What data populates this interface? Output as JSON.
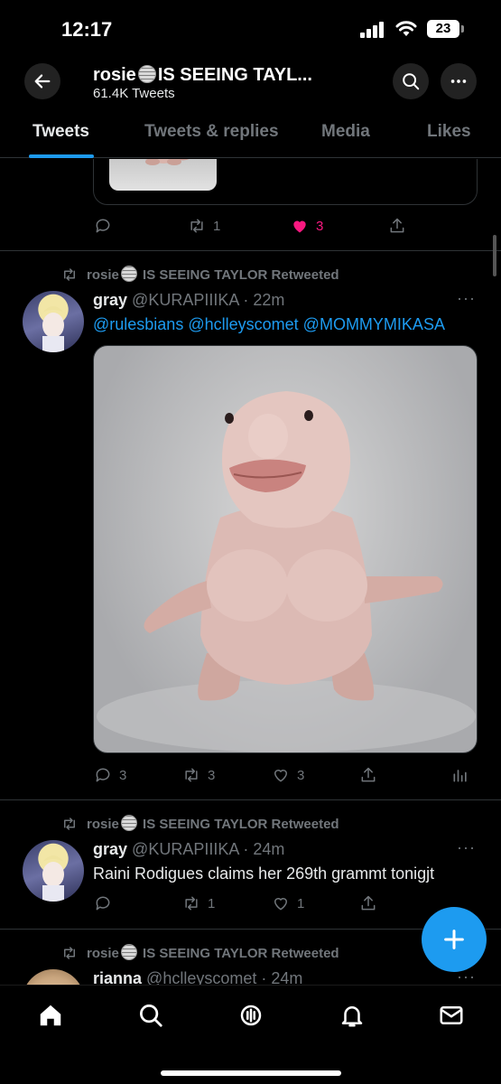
{
  "status_bar": {
    "time": "12:17",
    "battery": "23"
  },
  "header": {
    "title_prefix": "rosie",
    "title_suffix": "IS SEEING TAYL...",
    "subtitle": "61.4K Tweets"
  },
  "tabs": [
    {
      "label": "Tweets",
      "active": true
    },
    {
      "label": "Tweets & replies",
      "active": false
    },
    {
      "label": "Media",
      "active": false
    },
    {
      "label": "Likes",
      "active": false
    }
  ],
  "feed": {
    "previous_tweet_actions": {
      "retweets": "1",
      "likes": "3"
    },
    "tweets": [
      {
        "retweet_by_prefix": "rosie",
        "retweet_by_suffix": "IS SEEING TAYLOR Retweeted",
        "name": "gray",
        "handle_time": "@KURAPIIIKA · 22m",
        "mentions": [
          "@rulesbians",
          "@hclleyscomet",
          "@MOMMYMIKASA"
        ],
        "replies": "3",
        "retweets": "3",
        "likes": "3"
      },
      {
        "retweet_by_prefix": "rosie",
        "retweet_by_suffix": "IS SEEING TAYLOR Retweeted",
        "name": "gray",
        "handle_time": "@KURAPIIIKA · 24m",
        "text": "Raini Rodigues claims her 269th grammt tonigjt",
        "retweets": "1",
        "likes": "1"
      },
      {
        "retweet_by_prefix": "rosie",
        "retweet_by_suffix": "IS SEEING TAYLOR Retweeted",
        "name": "rianna",
        "handle_time": "@hclleyscomet · 24m"
      }
    ]
  },
  "colors": {
    "accent": "#1d9bf0",
    "like": "#f91880",
    "muted": "#71767b",
    "background": "#000000"
  },
  "icons": [
    "back-arrow-icon",
    "search-icon",
    "more-icon",
    "reply-icon",
    "retweet-icon",
    "heart-icon",
    "share-icon",
    "analytics-icon",
    "compose-plus-icon",
    "home-icon",
    "explore-icon",
    "spaces-icon",
    "notifications-icon",
    "messages-icon"
  ]
}
